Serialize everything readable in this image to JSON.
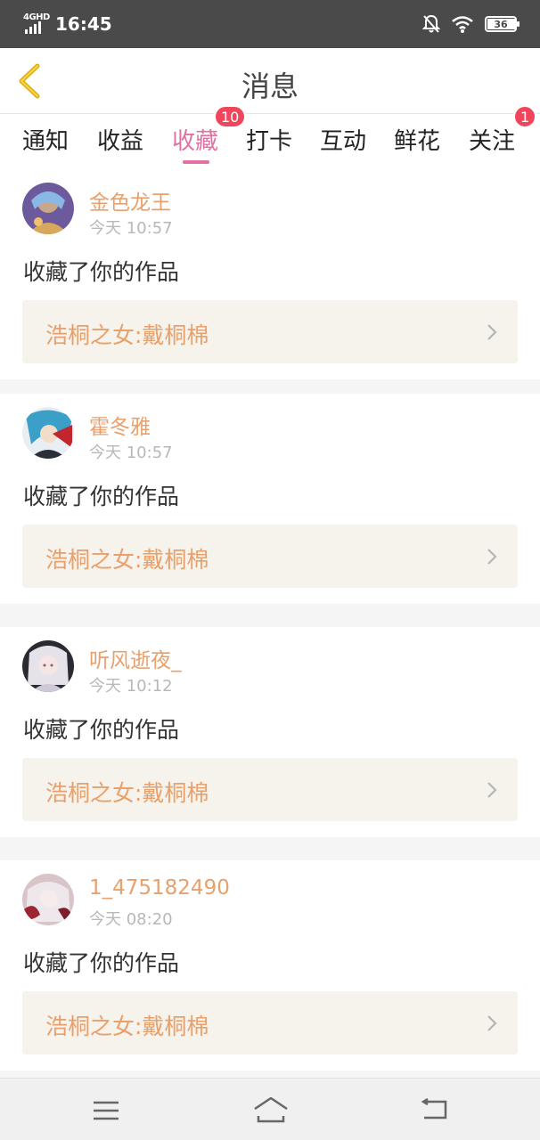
{
  "status_bar": {
    "network": "4GHD",
    "time": "16:45",
    "battery_level": "36",
    "icons": [
      "signal-icon",
      "bell-off-icon",
      "wifi-icon",
      "battery-icon"
    ]
  },
  "header": {
    "title": "消息",
    "back_icon": "back-chevron-icon"
  },
  "tabs": [
    {
      "label": "通知",
      "active": false,
      "badge": ""
    },
    {
      "label": "收益",
      "active": false,
      "badge": ""
    },
    {
      "label": "收藏",
      "active": true,
      "badge": "10"
    },
    {
      "label": "打卡",
      "active": false,
      "badge": ""
    },
    {
      "label": "互动",
      "active": false,
      "badge": ""
    },
    {
      "label": "鲜花",
      "active": false,
      "badge": ""
    },
    {
      "label": "关注",
      "active": false,
      "badge": "1"
    }
  ],
  "messages": [
    {
      "username": "金色龙王",
      "time": "今天 10:57",
      "action": "收藏了你的作品",
      "work": "浩桐之女:戴桐棉"
    },
    {
      "username": "霍冬雅",
      "time": "今天 10:57",
      "action": "收藏了你的作品",
      "work": "浩桐之女:戴桐棉"
    },
    {
      "username": "听风逝夜_",
      "time": "今天 10:12",
      "action": "收藏了你的作品",
      "work": "浩桐之女:戴桐棉"
    },
    {
      "username": "1_475182490",
      "time": "今天 08:20",
      "action": "收藏了你的作品",
      "work": "浩桐之女:戴桐棉"
    }
  ],
  "colors": {
    "accent_pink": "#e071a2",
    "name_orange": "#e8a06c",
    "badge_red": "#f0455b",
    "work_bg": "#f5f3ec"
  },
  "navbar": {
    "icons": [
      "menu-icon",
      "home-icon",
      "back-nav-icon"
    ]
  }
}
